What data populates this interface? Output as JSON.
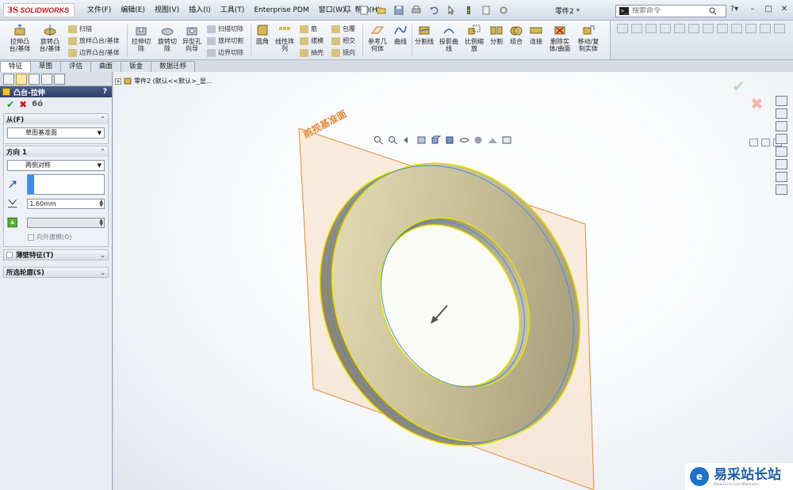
{
  "app": {
    "brand": "SOLIDWORKS",
    "document_title": "零件2 *"
  },
  "menu": [
    "文件(F)",
    "编辑(E)",
    "视图(V)",
    "插入(I)",
    "工具(T)",
    "Enterprise PDM",
    "窗口(W)",
    "帮助(H)"
  ],
  "search": {
    "placeholder": "搜索命令"
  },
  "ribbon": {
    "extruded_boss": "拉伸凸台/基体",
    "revolved_boss": "旋转凸台/基体",
    "sweep": "扫描",
    "loft": "放样凸台/基体",
    "boundary_boss": "边界凸台/基体",
    "extruded_cut": "拉伸切除",
    "revolved_cut": "旋转切除",
    "hole_wizard": "异型孔向导",
    "swept_cut": "扫描切除",
    "lofted_cut": "放样切割",
    "boundary_cut": "边界切除",
    "fillet": "圆角",
    "linear_pattern": "线性阵列",
    "rib": "筋",
    "draft": "拔模",
    "shell": "抽壳",
    "wrap": "包覆",
    "intersect": "相交",
    "mirror": "镜向",
    "ref_geometry": "参考几何体",
    "curves": "曲线",
    "split_line": "分割线",
    "projected_curve": "投影曲线",
    "scale": "比例缩放",
    "split": "分割",
    "combine": "组合",
    "join": "连接",
    "delete_body": "删除实体/曲面",
    "move_copy_body": "移动/复制实体"
  },
  "tabs": [
    "特征",
    "草图",
    "评估",
    "曲面",
    "钣金",
    "数据迁移"
  ],
  "property_manager": {
    "title": "凸台-拉伸",
    "help": "?",
    "from_label": "从(F)",
    "from_value": "草图基准面",
    "direction_label": "方向 1",
    "end_condition": "两侧对称",
    "depth_prefix": "D1",
    "depth_value": "1.60mm",
    "draft_outward": "向外拔模(O)",
    "thin_feature": "薄壁特征(T)",
    "selected_contours": "所选轮廓(S)"
  },
  "viewport": {
    "tree_path": "零件2 (默认<<默认>_显...",
    "plane_label": "前视基准面"
  },
  "watermark": {
    "text": "易采站长站",
    "sub": "Www.Easck.Com Webmaster"
  },
  "colors": {
    "plane_fill": "#f6dcc0",
    "plane_edge": "#e08a3a",
    "part_face": "#c8bc94",
    "part_highlight": "#f4ef7a",
    "edge_yellow": "#e8e000",
    "edge_blue": "#3f8fd6",
    "pm_header": "#34446e"
  }
}
